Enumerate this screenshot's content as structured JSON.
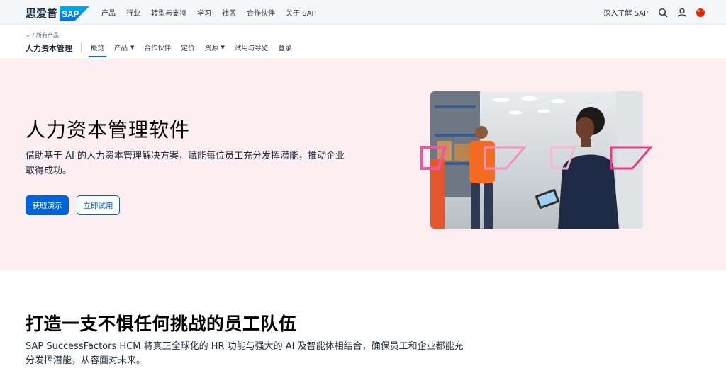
{
  "brand": {
    "cn_name": "思爱普",
    "logo_text": "SAP",
    "brand_color": "#0070f2"
  },
  "topnav": {
    "items": [
      "产品",
      "行业",
      "转型与支持",
      "学习",
      "社区",
      "合作伙伴",
      "关于 SAP"
    ]
  },
  "topright": {
    "learn_label": "深入了解 SAP",
    "search_icon": "search-icon",
    "user_icon": "user-icon",
    "flag_icon": "china-flag-icon"
  },
  "subnav": {
    "breadcrumb": "/ 所有产品",
    "title": "人力资本管理",
    "tabs": [
      {
        "label": "概览",
        "active": true,
        "has_dropdown": false
      },
      {
        "label": "产品",
        "active": false,
        "has_dropdown": true
      },
      {
        "label": "合作伙伴",
        "active": false,
        "has_dropdown": false
      },
      {
        "label": "定价",
        "active": false,
        "has_dropdown": false
      },
      {
        "label": "资源",
        "active": false,
        "has_dropdown": true
      },
      {
        "label": "试用与导览",
        "active": false,
        "has_dropdown": false
      },
      {
        "label": "登录",
        "active": false,
        "has_dropdown": false
      }
    ]
  },
  "hero": {
    "title": "人力资本管理软件",
    "description": "借助基于 AI 的人力资本管理解决方案，赋能每位员工充分发挥潜能，推动企业取得成功。",
    "primary_button": "获取演示",
    "secondary_button": "立即试用",
    "background_color": "#fdeef2",
    "accent_color": "#0064d9"
  },
  "section": {
    "title": "打造一支不惧任何挑战的员工队伍",
    "description": "SAP SuccessFactors HCM 将真正全球化的 HR 功能与强大的 AI 及智能体相结合，确保员工和企业都能充分发挥潜能，从容面对未来。"
  }
}
